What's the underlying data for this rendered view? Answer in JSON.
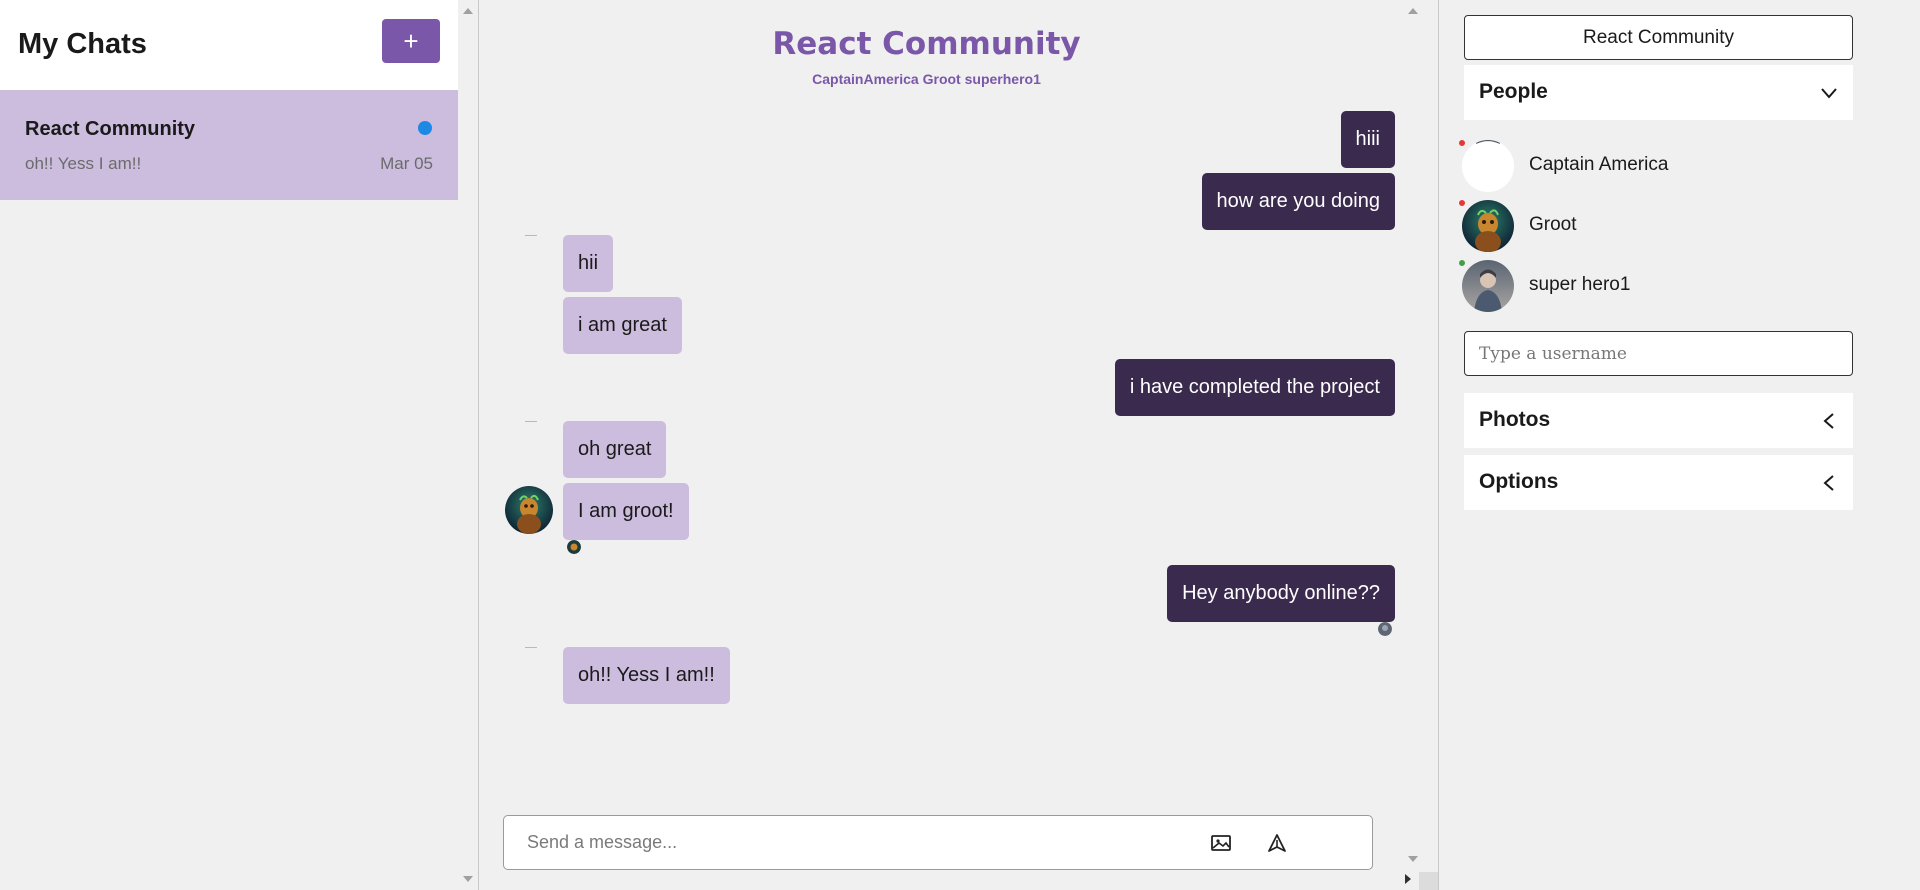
{
  "sidebar": {
    "title": "My Chats",
    "new_chat_label": "+",
    "chats": [
      {
        "title": "React Community",
        "preview": "oh!! Yess I am!!",
        "date": "Mar 05",
        "unread": true
      }
    ]
  },
  "chat": {
    "title": "React Community",
    "subtitle": "CaptainAmerica Groot superhero1",
    "messages": [
      {
        "text": "hiii",
        "mine": true
      },
      {
        "text": "how are you doing",
        "mine": true
      },
      {
        "text": "hii",
        "mine": false
      },
      {
        "text": "i am great",
        "mine": false
      },
      {
        "text": "i have completed the project",
        "mine": true
      },
      {
        "text": "oh great",
        "mine": false
      },
      {
        "text": "I am groot!",
        "mine": false
      },
      {
        "text": "Hey anybody online??",
        "mine": true
      },
      {
        "text": "oh!! Yess I am!!",
        "mine": false
      }
    ],
    "composer": {
      "placeholder": "Send a message..."
    }
  },
  "settings": {
    "group_name": "React Community",
    "people_label": "People",
    "people": [
      {
        "name": "Captain America",
        "online": false
      },
      {
        "name": "Groot",
        "online": false
      },
      {
        "name": "super hero1",
        "online": true
      }
    ],
    "username_placeholder": "Type a username",
    "photos_label": "Photos",
    "options_label": "Options"
  },
  "colors": {
    "accent": "#7a57a8",
    "my_bubble": "#3a2a4d",
    "their_bubble": "#ccbddf",
    "unread_dot": "#1e88e5",
    "offline": "#e53935",
    "online": "#43a047"
  }
}
